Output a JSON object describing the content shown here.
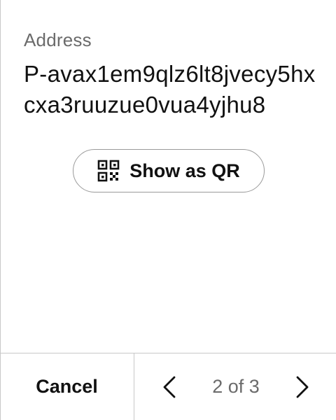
{
  "address": {
    "label": "Address",
    "value": "P-avax1em9qlz6lt8jvecy5hxcxa3ruuzue0vua4yjhu8"
  },
  "qr_button": {
    "label": "Show as QR",
    "icon": "qr-code-icon"
  },
  "footer": {
    "cancel_label": "Cancel",
    "pagination": {
      "text": "2 of 3",
      "current": 2,
      "total": 3,
      "prev_icon": "chevron-left-icon",
      "next_icon": "chevron-right-icon"
    }
  }
}
